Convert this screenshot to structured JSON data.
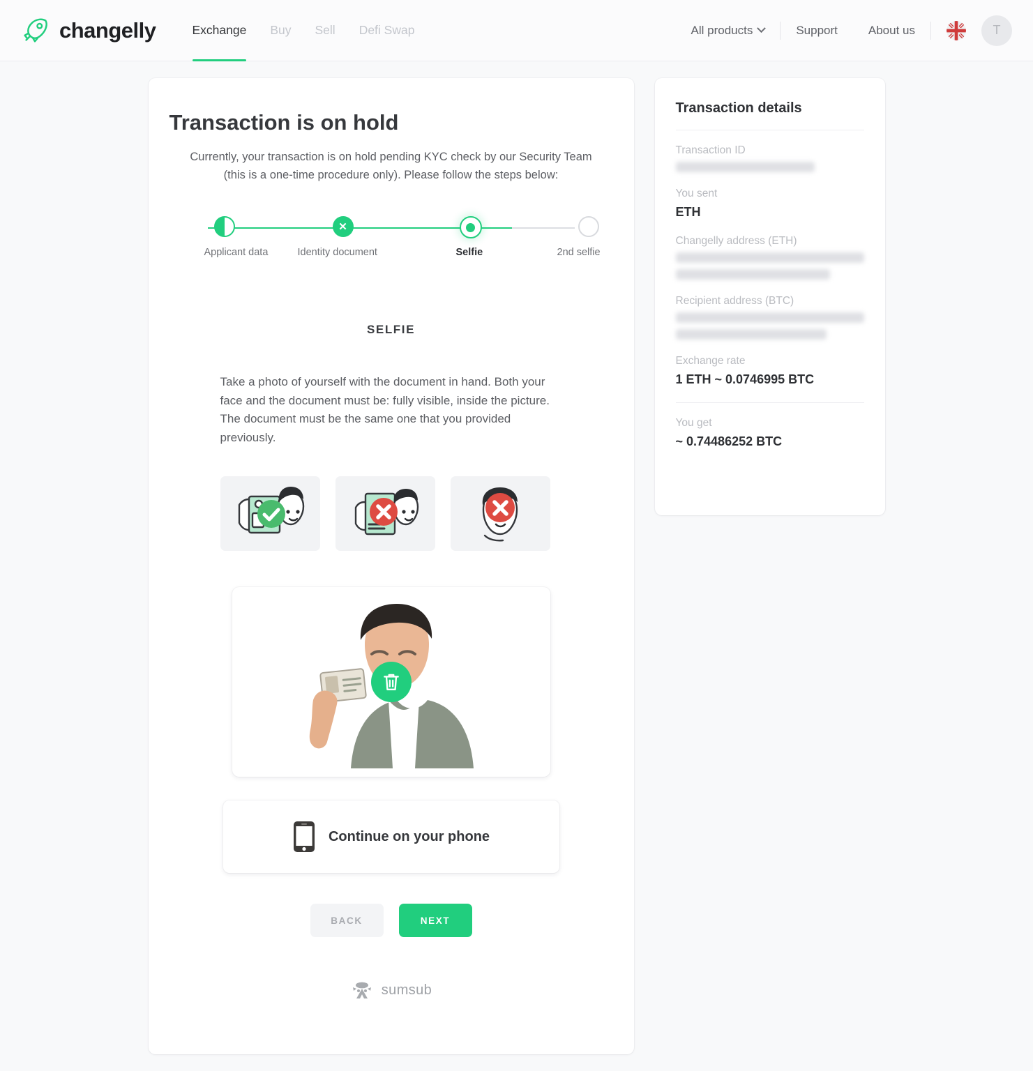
{
  "header": {
    "brand": "changelly",
    "brand_logo_icon": "rocket-icon",
    "nav": [
      {
        "label": "Exchange",
        "active": true
      },
      {
        "label": "Buy",
        "active": false
      },
      {
        "label": "Sell",
        "active": false
      },
      {
        "label": "Defi Swap",
        "active": false
      }
    ],
    "all_products": "All products",
    "support": "Support",
    "about_us": "About us",
    "language_flag_icon": "uk-flag-icon",
    "avatar_initial": "T"
  },
  "main": {
    "title": "Transaction is on hold",
    "lede": "Currently, your transaction is on hold pending KYC check by our Security Team (this is a one-time procedure only). Please follow the steps below:",
    "steps": [
      {
        "label": "Applicant data",
        "state": "partial"
      },
      {
        "label": "Identity document",
        "state": "rejected"
      },
      {
        "label": "Selfie",
        "state": "current"
      },
      {
        "label": "2nd selfie",
        "state": "pending"
      }
    ],
    "section_title": "SELFIE",
    "instructions": "Take a photo of yourself with the document in hand. Both your face and the document must be: fully visible, inside the picture. The document must be the same one that you provided previously.",
    "examples": [
      {
        "name": "example-good-document-and-face",
        "badge": "check"
      },
      {
        "name": "example-bad-document-covered",
        "badge": "cross"
      },
      {
        "name": "example-bad-no-document",
        "badge": "cross"
      }
    ],
    "preview": {
      "alt": "uploaded selfie holding id document",
      "delete_icon": "trash-icon"
    },
    "phone_card": {
      "label": "Continue on your phone",
      "icon": "mobile-phone-icon"
    },
    "buttons": {
      "back": "BACK",
      "next": "NEXT"
    },
    "footer_logo": "sumsub"
  },
  "details": {
    "title": "Transaction details",
    "rows": [
      {
        "label": "Transaction ID",
        "value": null,
        "redacted_lines": 1
      },
      {
        "label": "You sent",
        "value": "ETH",
        "redacted_lines": 0
      },
      {
        "label": "Changelly address (ETH)",
        "value": null,
        "redacted_lines": 2
      },
      {
        "label": "Recipient address (BTC)",
        "value": null,
        "redacted_lines": 2
      },
      {
        "label": "Exchange rate",
        "value": "1 ETH ~ 0.0746995 BTC",
        "redacted_lines": 0
      },
      {
        "label": "You get",
        "value": "~ 0.74486252 BTC",
        "redacted_lines": 0
      }
    ]
  },
  "colors": {
    "accent_green": "#21ce7e",
    "reject_red": "#de4b42",
    "page_bg": "#f8f9fa",
    "text_dark": "#2f3135",
    "text_muted": "#b9bbc0"
  }
}
